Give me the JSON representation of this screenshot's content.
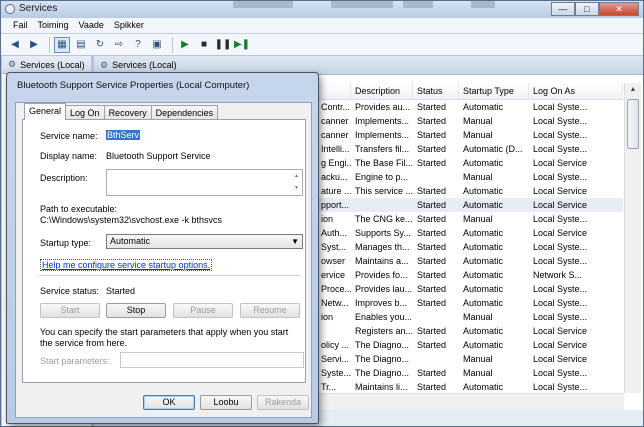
{
  "window": {
    "title": "Services",
    "menu": [
      "Fail",
      "Toiming",
      "Vaade",
      "Spikker"
    ],
    "left_pane_title": "Services (Local)",
    "right_pane_title": "Services (Local)"
  },
  "grid": {
    "headers": [
      "Description",
      "Status",
      "Startup Type",
      "Log On As"
    ],
    "rows": [
      {
        "name": "Contr...",
        "desc": "Provides au...",
        "status": "Started",
        "startup": "Automatic",
        "logon": "Local Syste..."
      },
      {
        "name": "canner",
        "desc": "Implements...",
        "status": "Started",
        "startup": "Manual",
        "logon": "Local Syste..."
      },
      {
        "name": "canner",
        "desc": "Implements...",
        "status": "Started",
        "startup": "Manual",
        "logon": "Local Syste..."
      },
      {
        "name": "Intelli...",
        "desc": "Transfers fil...",
        "status": "Started",
        "startup": "Automatic (D...",
        "logon": "Local Syste..."
      },
      {
        "name": "g Engi...",
        "desc": "The Base Fil...",
        "status": "Started",
        "startup": "Automatic",
        "logon": "Local Service"
      },
      {
        "name": "acku...",
        "desc": "Engine to p...",
        "status": "",
        "startup": "Manual",
        "logon": "Local Syste..."
      },
      {
        "name": "ature ...",
        "desc": "This service ...",
        "status": "Started",
        "startup": "Automatic",
        "logon": "Local Service"
      },
      {
        "name": "pport...",
        "desc": "",
        "status": "Started",
        "startup": "Automatic",
        "logon": "Local Service"
      },
      {
        "name": "ion",
        "desc": "The CNG ke...",
        "status": "Started",
        "startup": "Manual",
        "logon": "Local Syste..."
      },
      {
        "name": "Auth...",
        "desc": "Supports Sy...",
        "status": "Started",
        "startup": "Automatic",
        "logon": "Local Service"
      },
      {
        "name": "Syst...",
        "desc": "Manages th...",
        "status": "Started",
        "startup": "Automatic",
        "logon": "Local Syste..."
      },
      {
        "name": "owser",
        "desc": "Maintains a...",
        "status": "Started",
        "startup": "Automatic",
        "logon": "Local Syste..."
      },
      {
        "name": "ervice",
        "desc": "Provides fo...",
        "status": "Started",
        "startup": "Automatic",
        "logon": "Network S..."
      },
      {
        "name": "Proce...",
        "desc": "Provides lau...",
        "status": "Started",
        "startup": "Automatic",
        "logon": "Local Syste..."
      },
      {
        "name": "Netw...",
        "desc": "Improves b...",
        "status": "Started",
        "startup": "Automatic",
        "logon": "Local Syste..."
      },
      {
        "name": "ion",
        "desc": "Enables you...",
        "status": "",
        "startup": "Manual",
        "logon": "Local Syste..."
      },
      {
        "name": "",
        "desc": "Registers an...",
        "status": "Started",
        "startup": "Automatic",
        "logon": "Local Service"
      },
      {
        "name": "olicy ...",
        "desc": "The Diagno...",
        "status": "Started",
        "startup": "Automatic",
        "logon": "Local Service"
      },
      {
        "name": "Servi...",
        "desc": "The Diagno...",
        "status": "",
        "startup": "Manual",
        "logon": "Local Service"
      },
      {
        "name": "Syste...",
        "desc": "The Diagno...",
        "status": "Started",
        "startup": "Manual",
        "logon": "Local Syste..."
      },
      {
        "name": "Tr...",
        "desc": "Maintains li...",
        "status": "Started",
        "startup": "Automatic",
        "logon": "Local Syste..."
      }
    ]
  },
  "dialog": {
    "title": "Bluetooth Support Service Properties (Local Computer)",
    "tabs": [
      "General",
      "Log On",
      "Recovery",
      "Dependencies"
    ],
    "service_name_label": "Service name:",
    "service_name_value": "BthServ",
    "display_name_label": "Display name:",
    "display_name_value": "Bluetooth Support Service",
    "description_label": "Description:",
    "path_label": "Path to executable:",
    "path_value": "C:\\Windows\\system32\\svchost.exe -k bthsvcs",
    "startup_type_label": "Startup type:",
    "startup_type_value": "Automatic",
    "help_link": "Help me configure service startup options.",
    "service_status_label": "Service status:",
    "service_status_value": "Started",
    "buttons": {
      "start": "Start",
      "stop": "Stop",
      "pause": "Pause",
      "resume": "Resume"
    },
    "params_note": "You can specify the start parameters that apply when you start the service from here.",
    "start_params_label": "Start parameters:",
    "footer": {
      "ok": "OK",
      "cancel": "Loobu",
      "apply": "Rakenda"
    }
  }
}
